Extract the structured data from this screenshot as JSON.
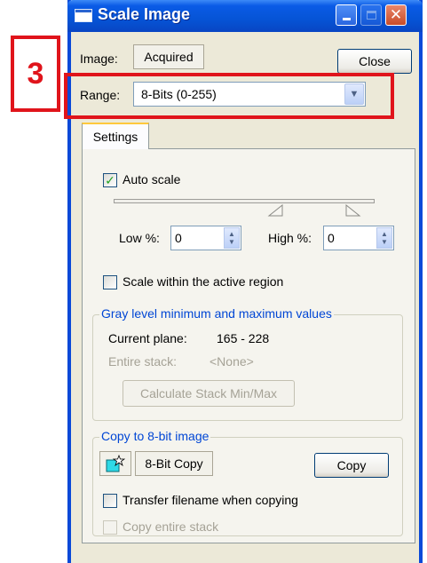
{
  "annotation": {
    "step_number": "3"
  },
  "window": {
    "title": "Scale Image"
  },
  "header": {
    "image_label": "Image:",
    "image_value": "Acquired",
    "close_label": "Close",
    "range_label": "Range:",
    "range_value": "8-Bits (0-255)"
  },
  "tabs": [
    {
      "label": "Settings",
      "selected": true
    }
  ],
  "settings": {
    "auto_scale_label": "Auto scale",
    "auto_scale_checked": true,
    "low_label": "Low %:",
    "low_value": "0",
    "high_label": "High %:",
    "high_value": "0",
    "scale_region_label": "Scale within the active region",
    "scale_region_checked": false
  },
  "gray_levels": {
    "title": "Gray level minimum and maximum values",
    "current_plane_label": "Current plane:",
    "current_plane_value": "165 - 228",
    "entire_stack_label": "Entire stack:",
    "entire_stack_value": "<None>",
    "calc_button_label": "Calculate Stack Min/Max"
  },
  "copy_group": {
    "title": "Copy to 8-bit image",
    "copy8_label": "8-Bit Copy",
    "copy_label": "Copy",
    "transfer_label": "Transfer filename when copying",
    "transfer_checked": false,
    "copy_stack_label": "Copy entire stack",
    "copy_stack_checked": false
  },
  "colors": {
    "annotation": "#e0141b",
    "titlebar": "#0654d6",
    "group_title": "#0046d5",
    "window_bg": "#ece9d8"
  }
}
